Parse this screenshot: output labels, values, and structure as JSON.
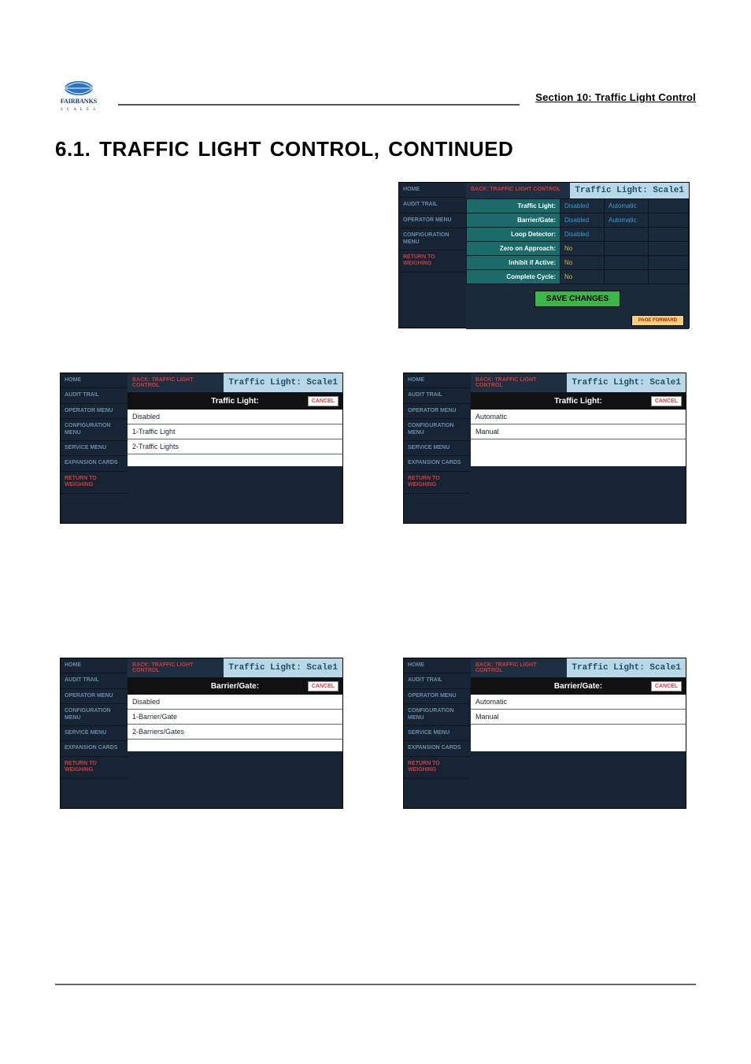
{
  "header": {
    "section_label": "Section 10:  Traffic Light Control",
    "logo_text": "FAIRBANKS",
    "page_heading": "6.1.  TRAFFIC LIGHT CONTROL, CONTINUED"
  },
  "main_panel": {
    "sidebar": [
      "HOME",
      "AUDIT TRAIL",
      "OPERATOR MENU",
      "CONFIGURATION MENU",
      "RETURN TO WEIGHING"
    ],
    "back_label": "BACK: TRAFFIC LIGHT CONTROL",
    "title": "Traffic Light: Scale1",
    "rows": [
      {
        "label": "Traffic Light:",
        "v1": "Disabled",
        "v1c": "blue",
        "v2": "Automatic",
        "v2c": "blue"
      },
      {
        "label": "Barrier/Gate:",
        "v1": "Disabled",
        "v1c": "blue",
        "v2": "Automatic",
        "v2c": "blue"
      },
      {
        "label": "Loop Detector:",
        "v1": "Disabled",
        "v1c": "blue",
        "v2": "",
        "v2c": "empty"
      },
      {
        "label": "Zero on Approach:",
        "v1": "No",
        "v1c": "yellow",
        "v2": "",
        "v2c": "empty"
      },
      {
        "label": "Inhibit if Active:",
        "v1": "No",
        "v1c": "yellow",
        "v2": "",
        "v2c": "empty"
      },
      {
        "label": "Complete Cycle:",
        "v1": "No",
        "v1c": "yellow",
        "v2": "",
        "v2c": "empty"
      }
    ],
    "save_label": "SAVE CHANGES",
    "page_forward": "PAGE FORWARD"
  },
  "sidebar_full": [
    "HOME",
    "AUDIT TRAIL",
    "OPERATOR MENU",
    "CONFIGURATION MENU",
    "SERVICE MENU",
    "EXPANSION CARDS",
    "RETURN TO WEIGHING"
  ],
  "common": {
    "back_label": "BACK: TRAFFIC LIGHT CONTROL",
    "title": "Traffic Light: Scale1",
    "cancel": "CANCEL"
  },
  "panel_tl_count": {
    "header": "Traffic Light:",
    "options": [
      "Disabled",
      "1-Traffic Light",
      "2-Traffic Lights"
    ]
  },
  "panel_tl_mode": {
    "header": "Traffic Light:",
    "options": [
      "Automatic",
      "Manual"
    ]
  },
  "panel_bg_count": {
    "header": "Barrier/Gate:",
    "options": [
      "Disabled",
      "1-Barrier/Gate",
      "2-Barriers/Gates"
    ]
  },
  "panel_bg_mode": {
    "header": "Barrier/Gate:",
    "options": [
      "Automatic",
      "Manual"
    ]
  }
}
